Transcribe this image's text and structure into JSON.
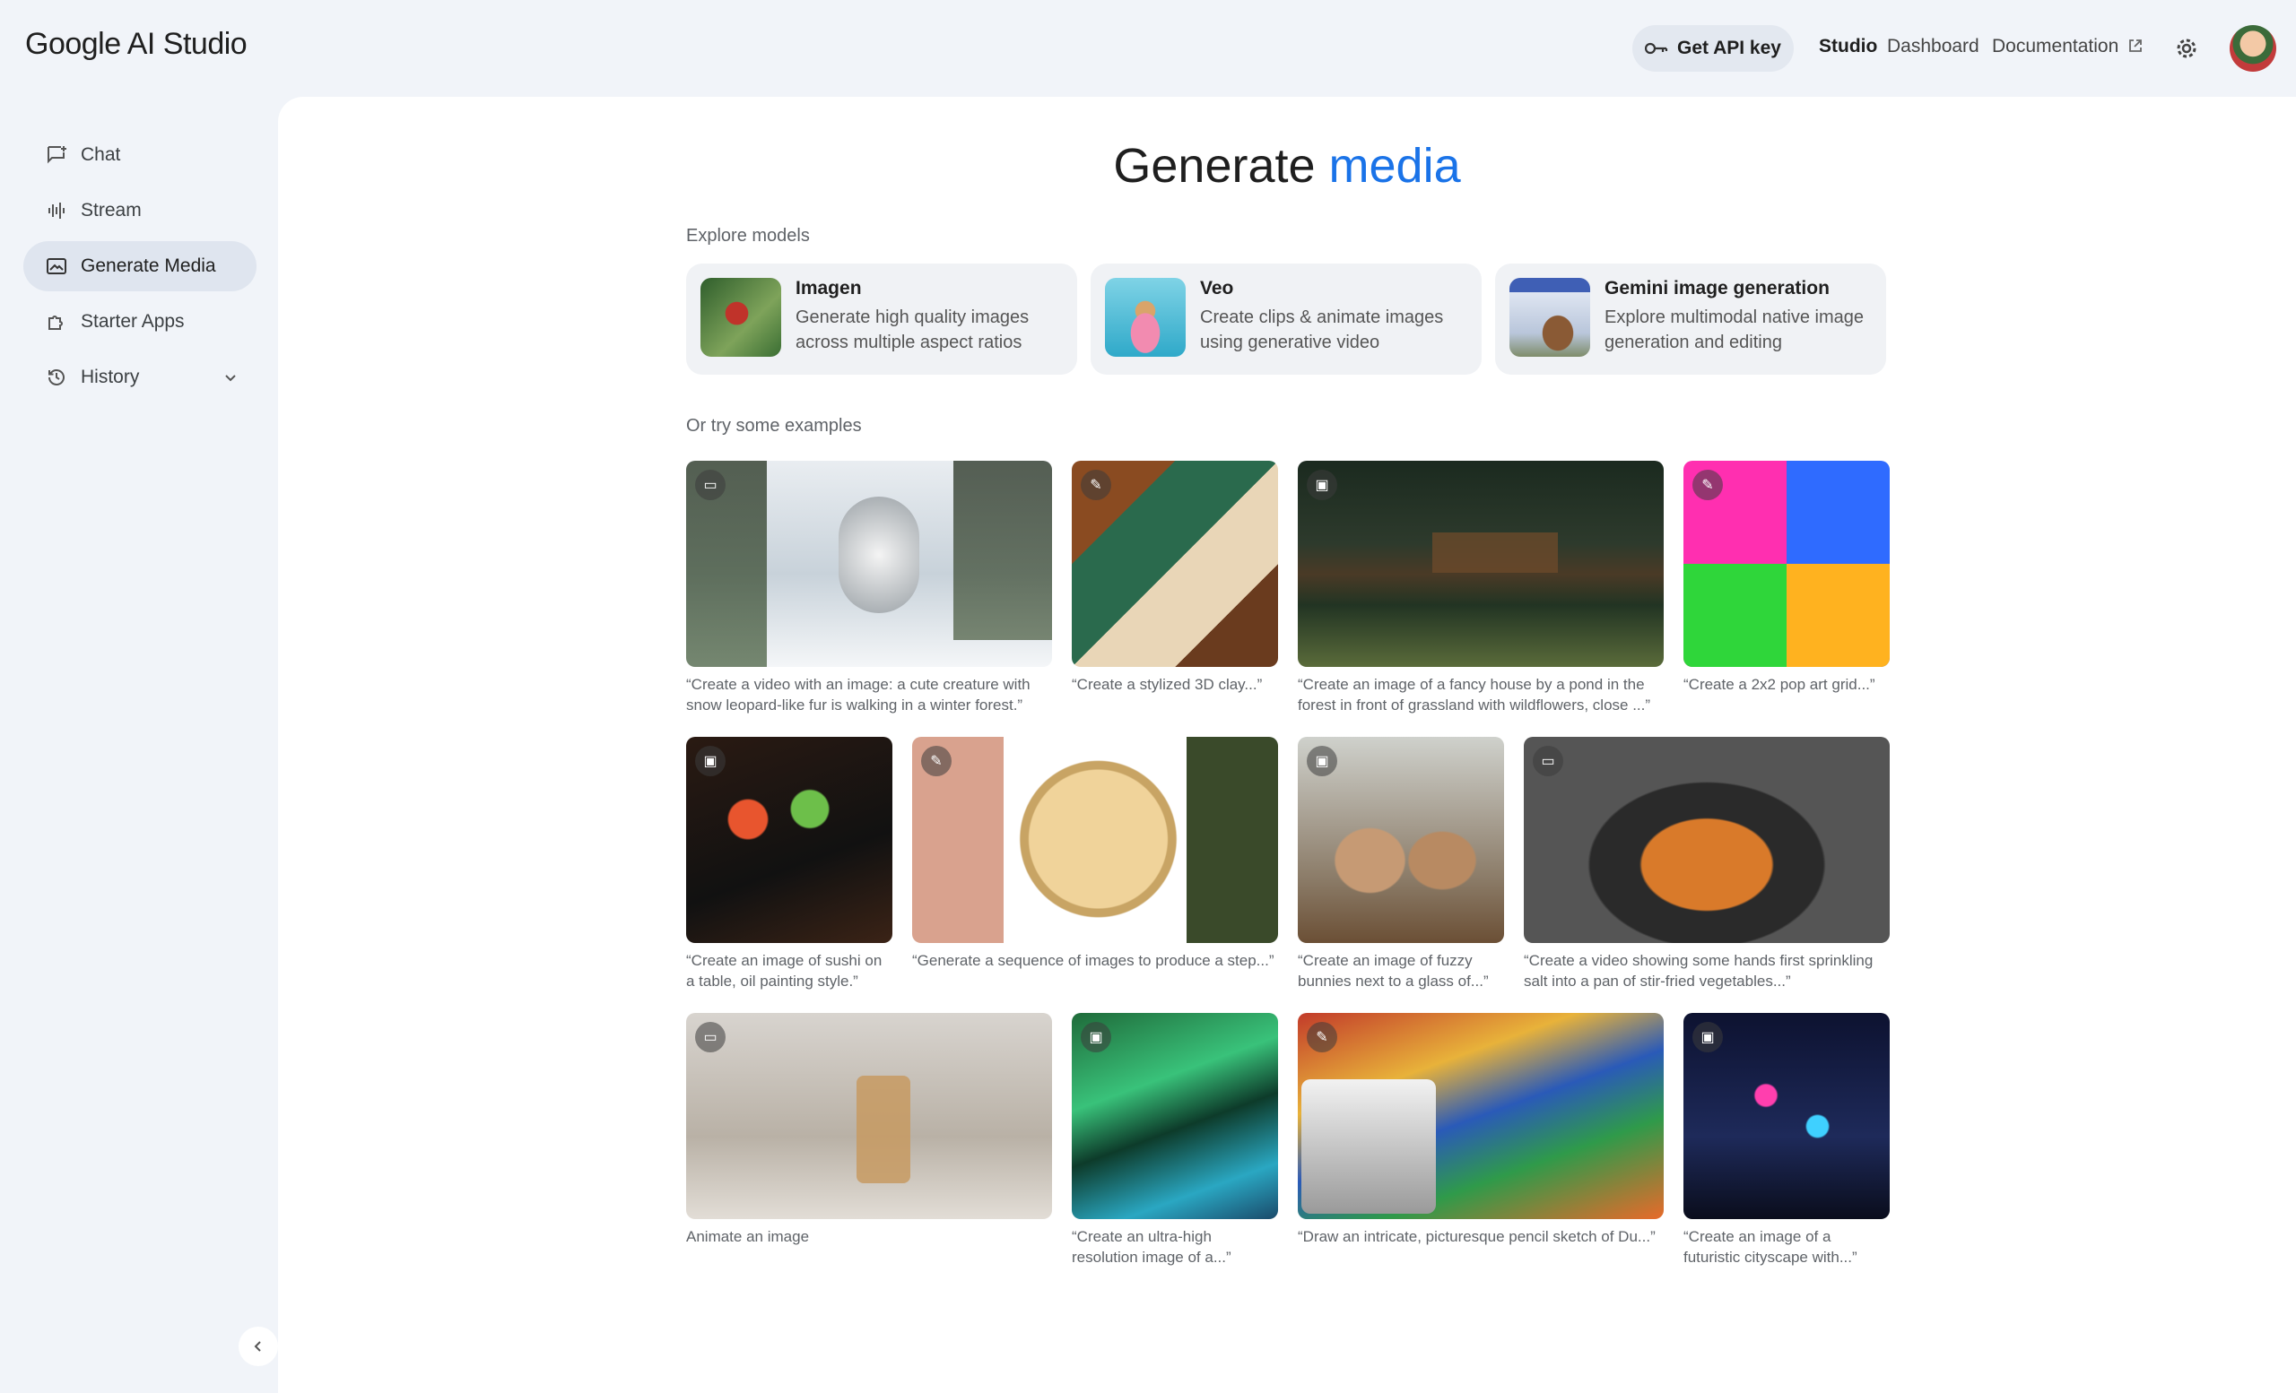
{
  "header": {
    "logo_google": "Google",
    "logo_product": "AI Studio",
    "api_key_label": "Get API key",
    "links": [
      "Studio",
      "Dashboard",
      "Documentation"
    ]
  },
  "sidebar": {
    "items": [
      {
        "label": "Chat",
        "icon": "chat-icon"
      },
      {
        "label": "Stream",
        "icon": "stream-icon"
      },
      {
        "label": "Generate Media",
        "icon": "image-icon",
        "active": true
      },
      {
        "label": "Starter Apps",
        "icon": "puzzle-icon"
      },
      {
        "label": "History",
        "icon": "history-icon"
      }
    ]
  },
  "main": {
    "title_plain": "Generate",
    "title_accent": "media",
    "explore_label": "Explore models",
    "examples_label": "Or try some examples",
    "models": [
      {
        "name": "Imagen",
        "desc": "Generate high quality images across multiple aspect ratios"
      },
      {
        "name": "Veo",
        "desc": "Create clips & animate images using generative video"
      },
      {
        "name": "Gemini image generation",
        "desc": "Explore multimodal native image generation and editing"
      }
    ],
    "examples": [
      {
        "caption": "“Create a video with an image: a cute creature with snow leopard-like fur is walking in a winter forest.”",
        "badge": "video-icon"
      },
      {
        "caption": "“Create a stylized 3D clay...”",
        "badge": "edit-image-icon"
      },
      {
        "caption": "“Create an image of a fancy house by a pond in the forest in front of grassland with wildflowers, close ...”",
        "badge": "image-icon"
      },
      {
        "caption": "“Create a 2x2 pop art grid...”",
        "badge": "edit-image-icon"
      },
      {
        "caption": "“Create an image of sushi on a table, oil painting style.”",
        "badge": "image-icon"
      },
      {
        "caption": "“Generate a sequence of images to produce a step...”",
        "badge": "edit-image-icon"
      },
      {
        "caption": "“Create an image of fuzzy bunnies next to a glass of...”",
        "badge": "image-icon"
      },
      {
        "caption": "“Create a video showing some hands first sprinkling salt into a pan of stir-fried vegetables...”",
        "badge": "video-icon"
      },
      {
        "caption": "Animate an image",
        "badge": "video-icon"
      },
      {
        "caption": "“Create an ultra-high resolution image of a...”",
        "badge": "image-icon"
      },
      {
        "caption": "“Draw an intricate, picturesque pencil sketch of Du...”",
        "badge": "edit-image-icon"
      },
      {
        "caption": "“Create an image of a futuristic cityscape with...”",
        "badge": "image-icon"
      }
    ]
  }
}
